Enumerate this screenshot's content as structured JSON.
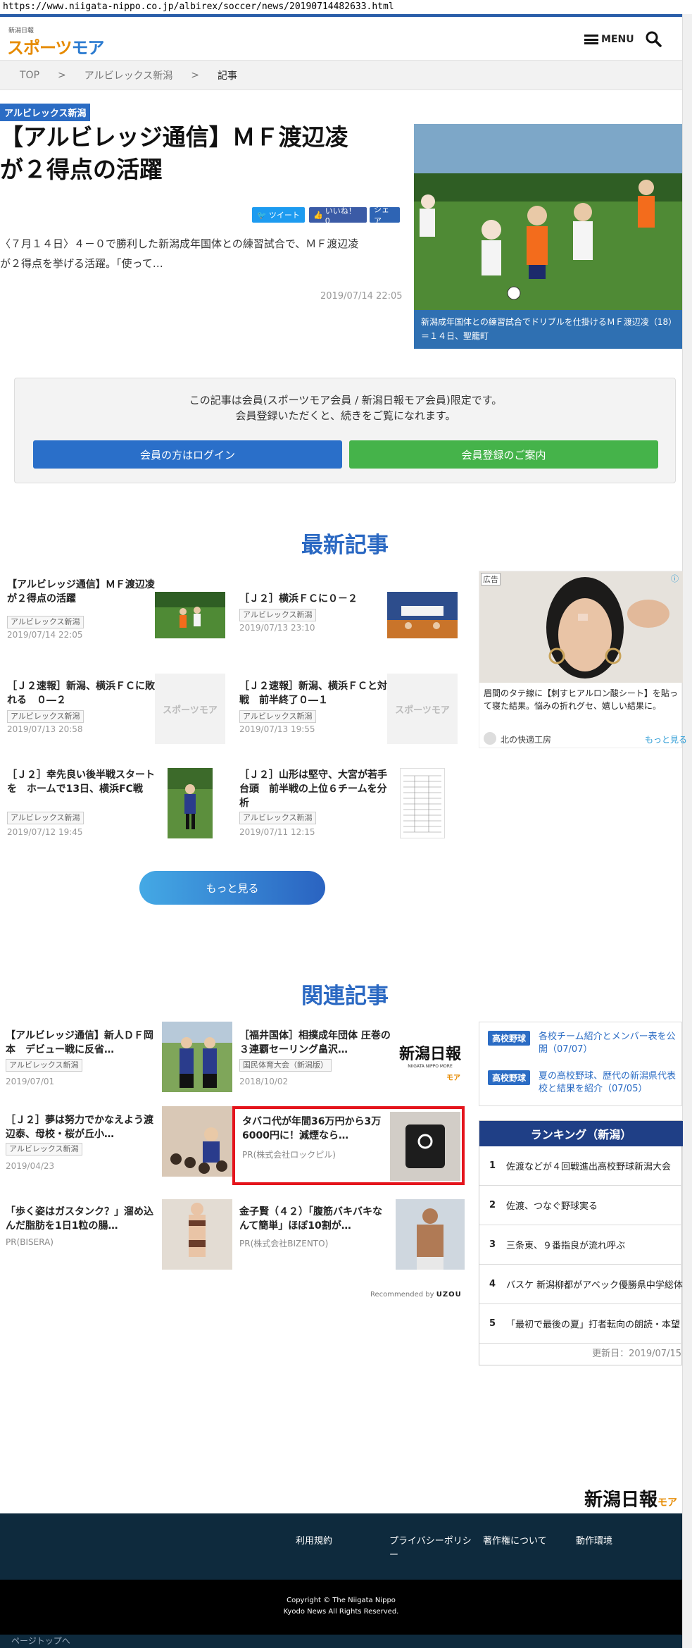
{
  "browser": {
    "url": "https://www.niigata-nippo.co.jp/albirex/soccer/news/20190714482633.html"
  },
  "header": {
    "logo_sub": "新潟日報",
    "logo_main_a": "スポーツ",
    "logo_main_b": "モア",
    "menu_label": "MENU"
  },
  "breadcrumb": {
    "items": [
      "TOP",
      "アルビレックス新潟",
      "記事"
    ],
    "separator": ">"
  },
  "article": {
    "category": "アルビレックス新潟",
    "title_line1": "【アルビレッジ通信】ＭＦ渡辺凌",
    "title_line2": "が２得点の活躍",
    "tweet_label": "ツイート",
    "like_label": "いいね！ 0",
    "share_label": "シェア",
    "lead_line1": "〈７月１４日〉４－０で勝利した新潟成年国体との練習試合で、ＭＦ渡辺凌",
    "lead_line2": "が２得点を挙げる活躍。「使って…",
    "date": "2019/07/14 22:05",
    "photo_caption": "新潟成年国体との練習試合でドリブルを仕掛けるＭＦ渡辺凌（18）＝１４日、聖籠町"
  },
  "member": {
    "line1": "この記事は会員(スポーツモア会員 / 新潟日報モア会員)限定です。",
    "line2": "会員登録いただくと、続きをご覧になれます。",
    "login_label": "会員の方はログイン",
    "register_label": "会員登録のご案内"
  },
  "latest": {
    "heading": "最新記事",
    "more_label": "もっと見る",
    "items": [
      {
        "title": "【アルビレッジ通信】ＭＦ渡辺凌が２得点の活躍",
        "tag": "アルビレックス新潟",
        "date": "2019/07/14 22:05"
      },
      {
        "title": "［Ｊ２］横浜ＦＣに０－２",
        "tag": "アルビレックス新潟",
        "date": "2019/07/13 23:10"
      },
      {
        "title": "［Ｊ２速報］新潟、横浜ＦＣに敗れる　０―２",
        "tag": "アルビレックス新潟",
        "date": "2019/07/13 20:58"
      },
      {
        "title": "［Ｊ２速報］新潟、横浜ＦＣと対戦　前半終了０―１",
        "tag": "アルビレックス新潟",
        "date": "2019/07/13 19:55"
      },
      {
        "title": "［Ｊ２］幸先良い後半戦スタートを　ホームで13日、横浜FC戦",
        "tag": "アルビレックス新潟",
        "date": "2019/07/12 19:45"
      },
      {
        "title": "［Ｊ２］山形は堅守、大宮が若手台頭　前半戦の上位６チームを分析",
        "tag": "アルビレックス新潟",
        "date": "2019/07/11 12:15"
      }
    ],
    "noimage_label": "スポーツモア"
  },
  "ad": {
    "label": "広告",
    "text": "眉間のタテ線に【刺すヒアルロン酸シート】を貼って寝た結果。悩みの折れグセ、嬉しい結果に。",
    "sponsor": "北の快適工房",
    "more": "もっと見る"
  },
  "related": {
    "heading": "関連記事",
    "items": [
      {
        "title": "【アルビレッジ通信】新人ＤＦ岡本　デビュー戦に反省…",
        "tag": "アルビレックス新潟",
        "date": "2019/07/01"
      },
      {
        "title": "［福井国体］相撲成年団体 圧巻の３連覇セーリング畠沢…",
        "tag": "国民体育大会（新潟版）",
        "date": "2018/10/02"
      },
      {
        "title": "［Ｊ２］夢は努力でかなえよう渡辺泰、母校・桜が丘小…",
        "tag": "アルビレックス新潟",
        "date": "2019/04/23"
      }
    ],
    "pr": [
      {
        "title": "タバコ代が年間36万円から3万6000円に！減煙なら…",
        "source": "PR(株式会社ロックピル)"
      },
      {
        "title": "「歩く姿はガスタンク？」溜め込んだ脂肪を1日1粒の腸…",
        "source": "PR(BISERA)"
      },
      {
        "title": "金子賢（４２）「腹筋バキバキなんて簡単」ほぼ10割が…",
        "source": "PR(株式会社BIZENTO)"
      }
    ],
    "logo_text": "新潟日報",
    "logo_sub": "NIIGATA NIPPO MORE",
    "logo_more": "モア",
    "reco_prefix": "Recommended by",
    "reco_brand": "UZOU"
  },
  "sidebar": {
    "highschool": [
      {
        "tag": "高校野球",
        "text": "各校チーム紹介とメンバー表を公開（07/07）"
      },
      {
        "tag": "高校野球",
        "text": "夏の高校野球、歴代の新潟県代表校と結果を紹介（07/05）"
      }
    ],
    "ranking_title": "ランキング（新潟）",
    "ranking": [
      {
        "rank": "1",
        "text": "佐渡などが４回戦進出高校野球新潟大会"
      },
      {
        "rank": "2",
        "text": "佐渡、つなぐ野球実る"
      },
      {
        "rank": "3",
        "text": "三条東、９番指良が流れ呼ぶ"
      },
      {
        "rank": "4",
        "text": "バスケ 新潟柳都がアベック優勝県中学総体"
      },
      {
        "rank": "5",
        "text": "「最初で最後の夏」打者転向の朗読・本望"
      }
    ],
    "updated": "更新日：2019/07/15"
  },
  "footer": {
    "logo": "新潟日報",
    "logo_more": "モア",
    "links": [
      "利用規約",
      "プライバシーポリシー",
      "著作権について",
      "動作環境"
    ],
    "copy1": "Copyright © The Niigata Nippo",
    "copy2": "Kyodo News All Rights Reserved.",
    "pagetop": "ページトップへ"
  },
  "colors": {
    "brand_blue": "#2b6cc4",
    "brand_orange": "#e68a00",
    "login": "#2a6fc9",
    "register": "#45b34a",
    "footer": "#0e2a3d"
  }
}
